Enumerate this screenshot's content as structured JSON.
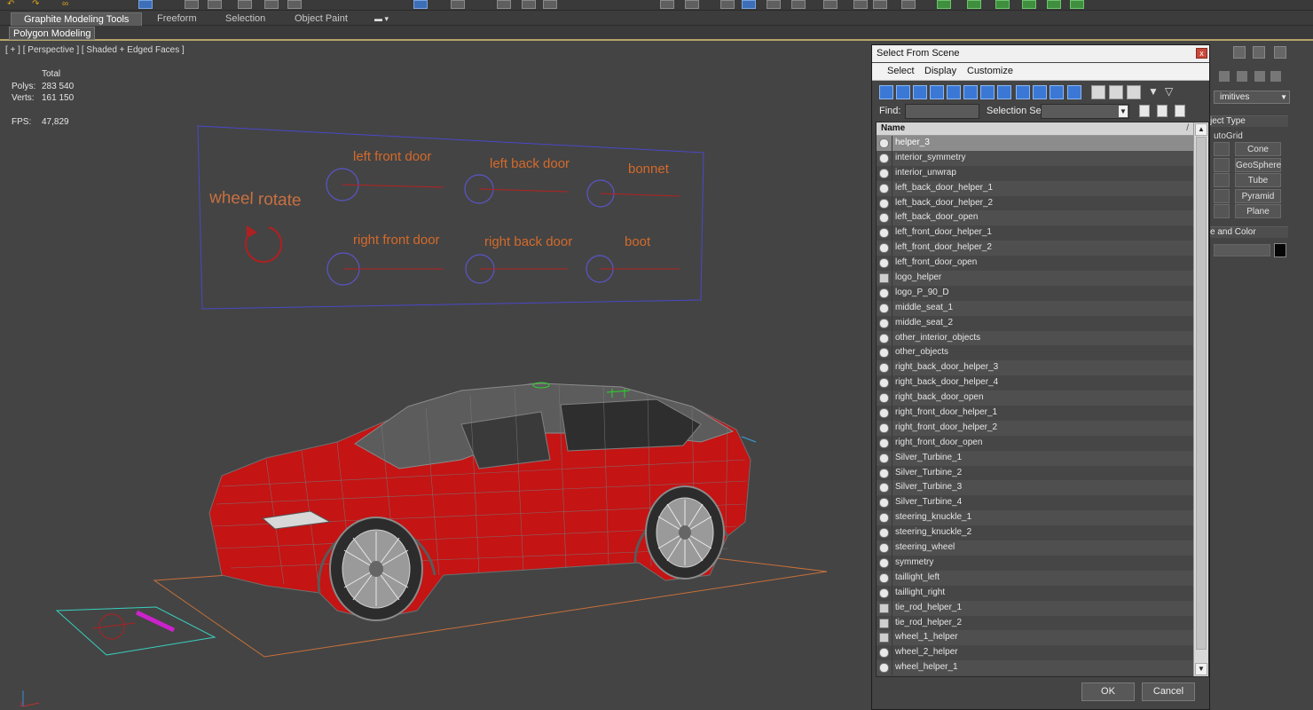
{
  "ribbon": {
    "tabs": [
      "Graphite Modeling Tools",
      "Freeform",
      "Selection",
      "Object Paint"
    ],
    "subtab": "Polygon Modeling"
  },
  "viewport": {
    "label": "[ + ] [ Perspective ] [ Shaded + Edged Faces ]",
    "stats": {
      "total_label": "Total",
      "polys_label": "Polys:",
      "polys_value": "283 540",
      "verts_label": "Verts:",
      "verts_value": "161 150",
      "fps_label": "FPS:",
      "fps_value": "47,829"
    },
    "control_panel": {
      "wheel_rotate": "wheel rotate",
      "left_front_door": "left front door",
      "left_back_door": "left back door",
      "bonnet": "bonnet",
      "right_front_door": "right front door",
      "right_back_door": "right back door",
      "boot": "boot"
    },
    "axis_label": "z"
  },
  "command_panel": {
    "dropdown": "imitives",
    "section_object_type": "ject Type",
    "autogrid": "utoGrid",
    "buttons": [
      "Cone",
      "GeoSphere",
      "Tube",
      "Pyramid",
      "Plane"
    ],
    "section_name_color": "e and Color"
  },
  "dialog": {
    "title": "Select From Scene",
    "close": "x",
    "menu": [
      "Select",
      "Display",
      "Customize"
    ],
    "find_label": "Find:",
    "find_value": "",
    "selection_set_label": "Selection Set:",
    "selection_set_value": "",
    "column_name": "Name",
    "sort_indicator": "/",
    "items": [
      "helper_3",
      "interior_symmetry",
      "interior_unwrap",
      "left_back_door_helper_1",
      "left_back_door_helper_2",
      "left_back_door_open",
      "left_front_door_helper_1",
      "left_front_door_helper_2",
      "left_front_door_open",
      "logo_helper",
      "logo_P_90_D",
      "middle_seat_1",
      "middle_seat_2",
      "other_interior_objects",
      "other_objects",
      "right_back_door_helper_3",
      "right_back_door_helper_4",
      "right_back_door_open",
      "right_front_door_helper_1",
      "right_front_door_helper_2",
      "right_front_door_open",
      "Silver_Turbine_1",
      "Silver_Turbine_2",
      "Silver_Turbine_3",
      "Silver_Turbine_4",
      "steering_knuckle_1",
      "steering_knuckle_2",
      "steering_wheel",
      "symmetry",
      "taillight_left",
      "taillight_right",
      "tie_rod_helper_1",
      "tie_rod_helper_2",
      "wheel_1_helper",
      "wheel_2_helper",
      "wheel_helper_1"
    ],
    "selected_item": "helper_3",
    "ok_label": "OK",
    "cancel_label": "Cancel"
  },
  "colors": {
    "car_body": "#c41414",
    "control_text": "#d46a2a",
    "control_circle": "#5a55c8",
    "stats_text": "#e3e317",
    "ribbon_accent": "#b8a46a"
  }
}
